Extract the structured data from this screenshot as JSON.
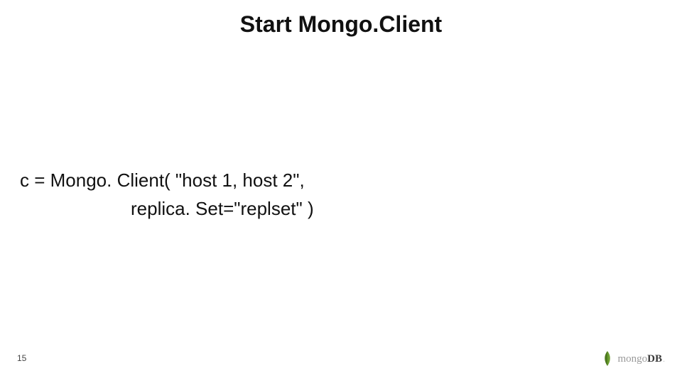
{
  "slide": {
    "title": "Start Mongo.Client",
    "code": {
      "line1": "c = Mongo. Client( \"host 1, host 2\",",
      "line2": "replica. Set=\"replset\" )"
    },
    "page_number": "15",
    "brand": {
      "prefix": "mongo",
      "suffix": "DB",
      "dot": ".",
      "leaf_color": "#6b9e2f",
      "leaf_shadow": "#4d7a1f"
    }
  }
}
